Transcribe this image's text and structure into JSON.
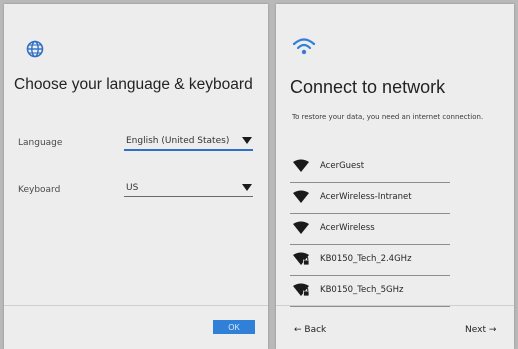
{
  "colors": {
    "accent": "#2f80d6",
    "panel": "#ededed"
  },
  "language_panel": {
    "icon": "globe-icon",
    "title": "Choose your language & keyboard",
    "language": {
      "label": "Language",
      "value": "English (United States)"
    },
    "keyboard": {
      "label": "Keyboard",
      "value": "US"
    },
    "ok_label": "OK"
  },
  "network_panel": {
    "icon": "wifi-icon",
    "title": "Connect to network",
    "subtitle": "To restore your data, you need an internet connection.",
    "networks": [
      {
        "name": "AcerGuest",
        "secured": false
      },
      {
        "name": "AcerWireless-Intranet",
        "secured": false
      },
      {
        "name": "AcerWireless",
        "secured": false
      },
      {
        "name": "KB0150_Tech_2.4GHz",
        "secured": true
      },
      {
        "name": "KB0150_Tech_5GHz",
        "secured": true
      }
    ],
    "back_label": "← Back",
    "next_label": "Next →"
  }
}
